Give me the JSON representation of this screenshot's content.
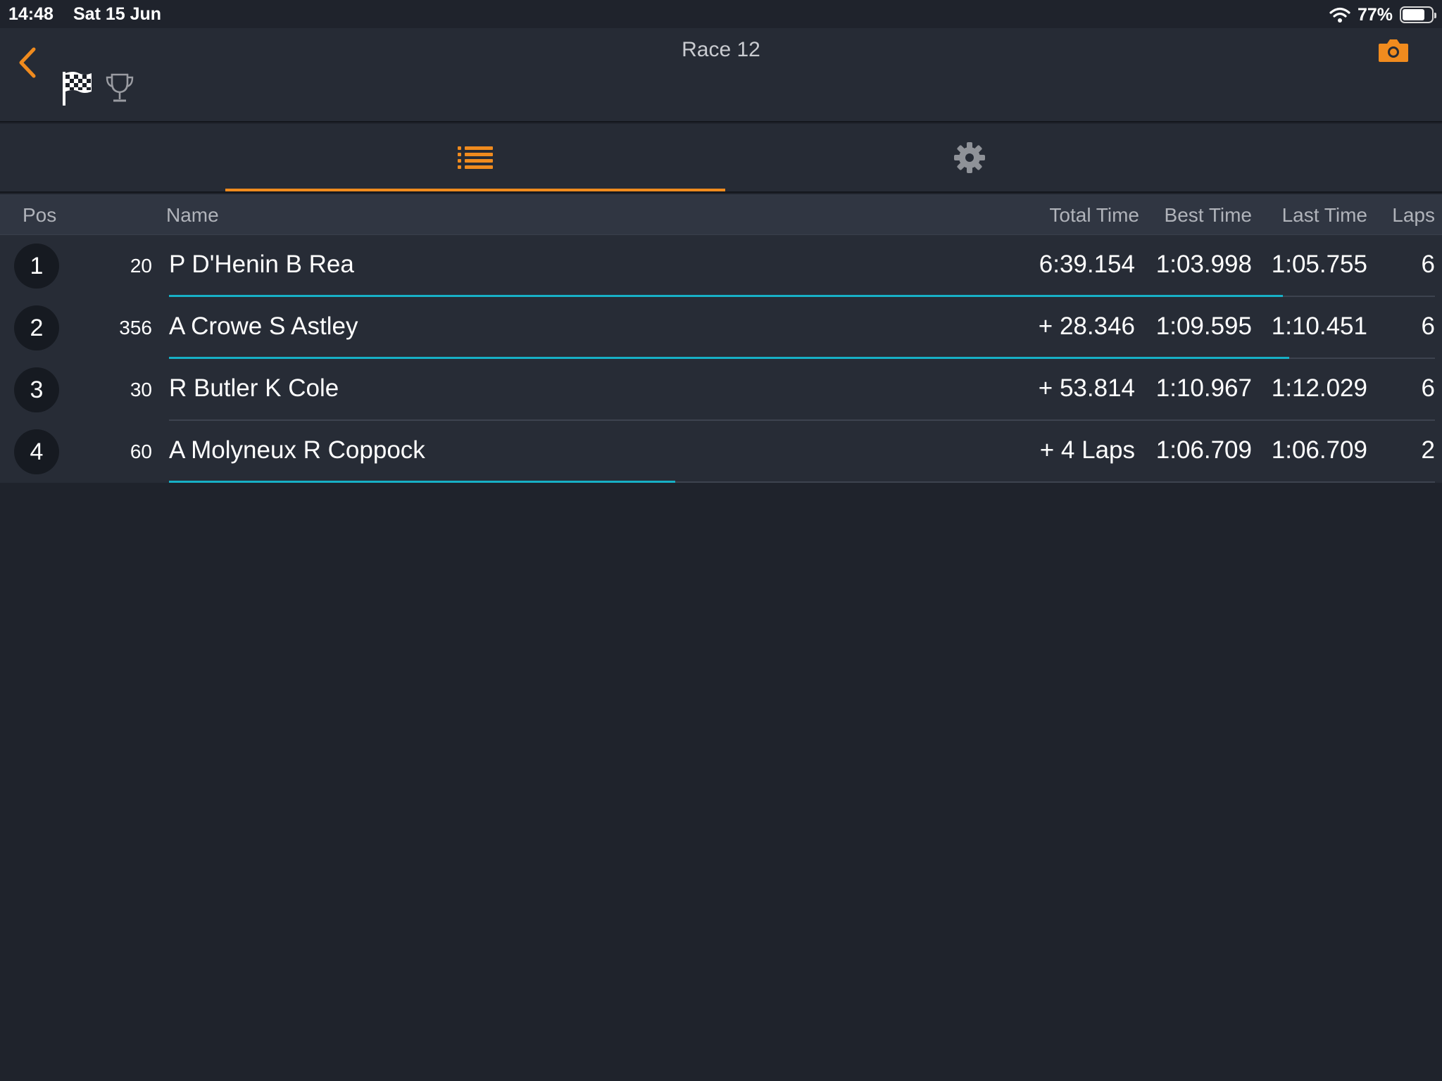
{
  "status_bar": {
    "time": "14:48",
    "date": "Sat 15 Jun",
    "battery_percent": "77%",
    "battery_level": 0.77
  },
  "nav": {
    "title": "Race 12",
    "icons": [
      "chevron-left-icon",
      "checkered-flag-icon",
      "trophy-icon",
      "camera-icon"
    ]
  },
  "tabs": [
    {
      "name": "list",
      "icon": "list-icon",
      "active": true
    },
    {
      "name": "settings",
      "icon": "gear-icon",
      "active": false
    }
  ],
  "table": {
    "headers": {
      "pos": "Pos",
      "name": "Name",
      "total_time": "Total Time",
      "best_time": "Best Time",
      "last_time": "Last Time",
      "laps": "Laps"
    },
    "rows": [
      {
        "pos": "1",
        "number": "20",
        "name": "P D'Henin B Rea",
        "total_time": "6:39.154",
        "best_time": "1:03.998",
        "last_time": "1:05.755",
        "laps": "6",
        "progress": 0.88
      },
      {
        "pos": "2",
        "number": "356",
        "name": "A Crowe S Astley",
        "total_time": "+ 28.346",
        "best_time": "1:09.595",
        "last_time": "1:10.451",
        "laps": "6",
        "progress": 0.885
      },
      {
        "pos": "3",
        "number": "30",
        "name": "R Butler K Cole",
        "total_time": "+ 53.814",
        "best_time": "1:10.967",
        "last_time": "1:12.029",
        "laps": "6",
        "progress": 0
      },
      {
        "pos": "4",
        "number": "60",
        "name": "A Molyneux R Coppock",
        "total_time": "+ 4 Laps",
        "best_time": "1:06.709",
        "last_time": "1:06.709",
        "laps": "2",
        "progress": 0.4
      }
    ]
  },
  "colors": {
    "accent": "#f08b1e",
    "progress": "#17b0c6",
    "background": "#1f232c",
    "bar": "#262b35"
  }
}
